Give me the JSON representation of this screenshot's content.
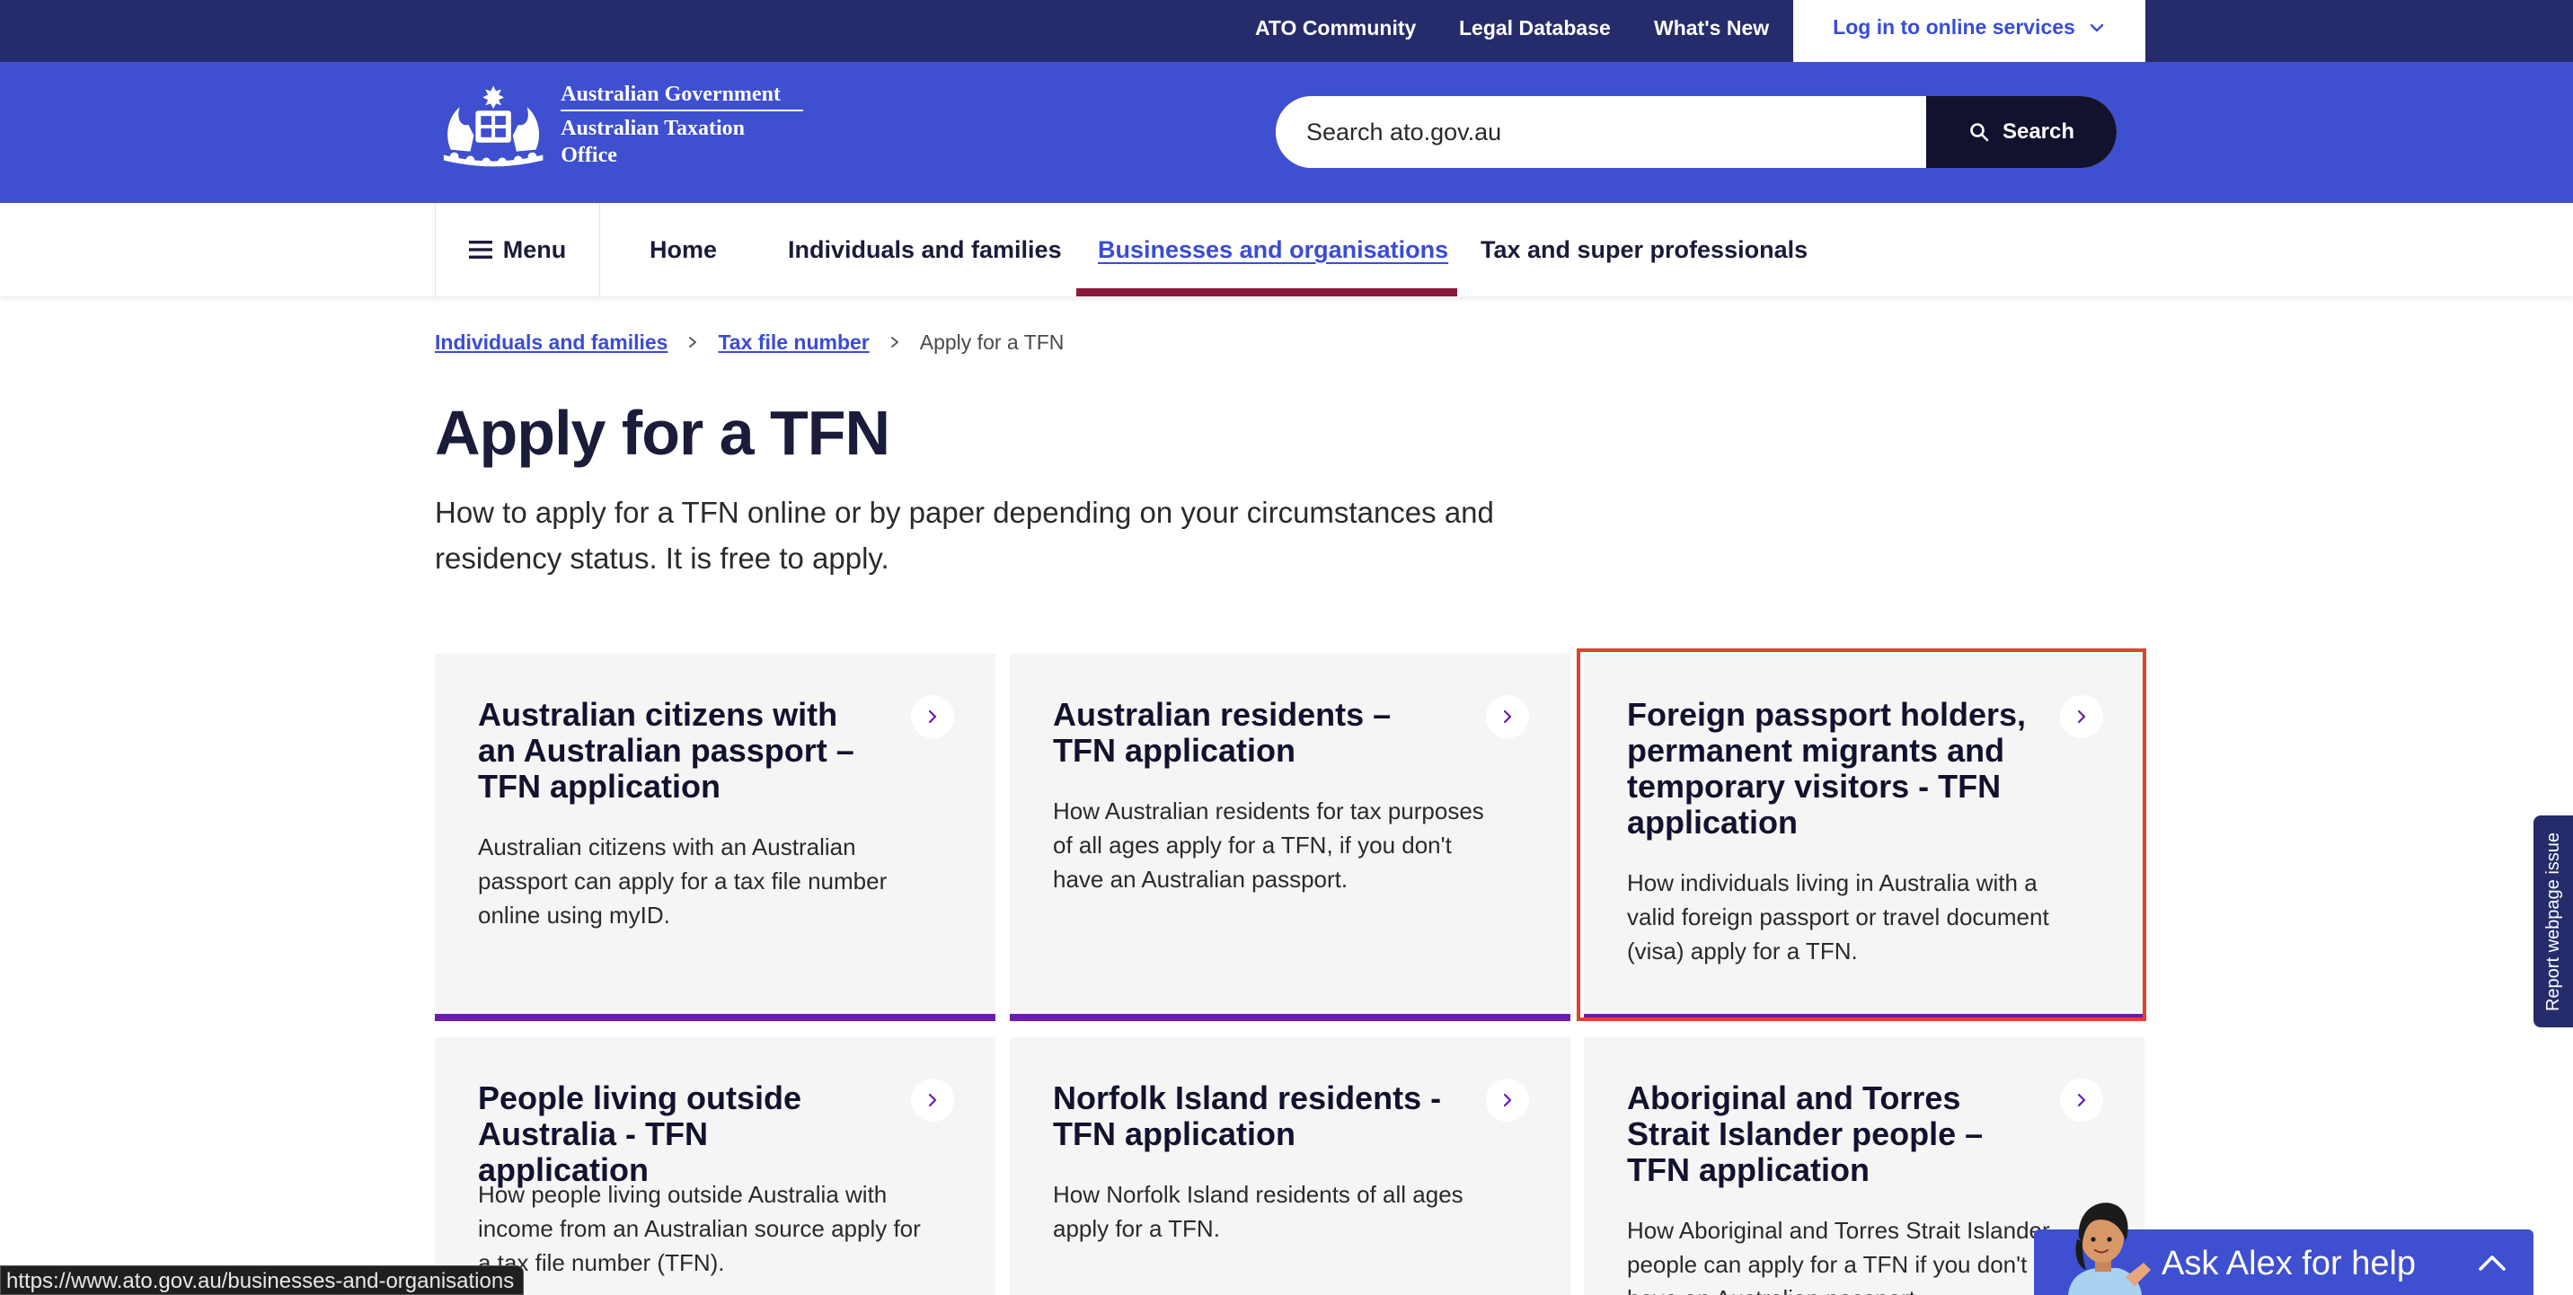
{
  "utility_bar": {
    "links": [
      "ATO Community",
      "Legal Database",
      "What's New"
    ],
    "login_label": "Log in to online services"
  },
  "header": {
    "logo_line1": "Australian Government",
    "logo_line2": "Australian Taxation Office",
    "search_placeholder": "Search ato.gov.au",
    "search_button": "Search"
  },
  "nav": {
    "menu_label": "Menu",
    "items": [
      "Home",
      "Individuals and families",
      "Businesses and organisations",
      "Tax and super professionals"
    ],
    "active_item": "Businesses and organisations"
  },
  "breadcrumb": {
    "items": [
      "Individuals and families",
      "Tax file number"
    ],
    "current": "Apply for a TFN"
  },
  "page": {
    "title": "Apply for a TFN",
    "intro": "How to apply for a TFN online or by paper depending on your circumstances and residency status. It is free to apply."
  },
  "cards": [
    {
      "title": "Australian citizens with an Australian passport – TFN application",
      "description": "Australian citizens with an Australian passport can apply for a tax file number online using myID."
    },
    {
      "title": "Australian residents – TFN application",
      "description": "How Australian residents for tax purposes of all ages apply for a TFN, if you don't have an Australian passport."
    },
    {
      "title": "Foreign passport holders, permanent migrants and temporary visitors - TFN application",
      "description": "How individuals living in Australia with a valid foreign passport or travel document (visa) apply for a TFN."
    },
    {
      "title": "People living outside Australia - TFN application",
      "description": "How people living outside Australia with income from an Australian source apply for a tax file number (TFN)."
    },
    {
      "title": "Norfolk Island residents - TFN application",
      "description": "How Norfolk Island residents of all ages apply for a TFN."
    },
    {
      "title": "Aboriginal and Torres Strait Islander people – TFN application",
      "description": "How Aboriginal and Torres Strait Islander people can apply for a TFN if you don't have an Australian passport."
    }
  ],
  "feedback_tab": "Report webpage issue",
  "chat": {
    "label": "Ask Alex for help"
  },
  "status_url": "https://www.ato.gov.au/businesses-and-organisations",
  "colors": {
    "utility_bar": "#262c6b",
    "header": "#3e4fcf",
    "card_accent": "#6a1bb0",
    "nav_active": "#8a1a3c",
    "highlight": "#e1422a"
  },
  "icons": [
    "chevron-down-icon",
    "search-icon",
    "hamburger-icon",
    "chevron-right-icon",
    "chevron-up-icon",
    "crest-icon",
    "avatar-icon"
  ]
}
